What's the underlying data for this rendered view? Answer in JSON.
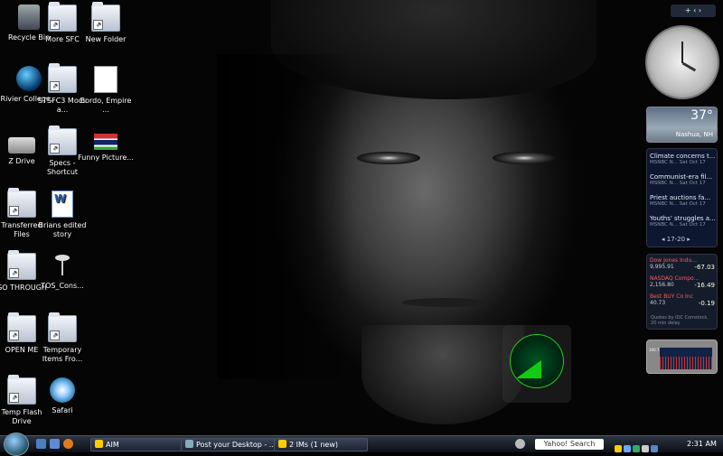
{
  "desktop_icons": [
    {
      "label": "Recycle Bin",
      "icon": "recycle-bin-icon"
    },
    {
      "label": "More SFC",
      "icon": "folder-icon"
    },
    {
      "label": "New Folder",
      "icon": "folder-icon"
    },
    {
      "label": "Rivier College...",
      "icon": "globe-icon"
    },
    {
      "label": "STSFC3 Mods a...",
      "icon": "folder-icon"
    },
    {
      "label": "Bordo, Empire ...",
      "icon": "pdf-document-icon"
    },
    {
      "label": "Z Drive",
      "icon": "network-drive-icon"
    },
    {
      "label": "Specs - Shortcut",
      "icon": "folder-icon"
    },
    {
      "label": "Funny Picture...",
      "icon": "image-icon"
    },
    {
      "label": "Transferred Files",
      "icon": "folder-icon"
    },
    {
      "label": "Brians edited story",
      "icon": "word-document-icon"
    },
    {
      "label": "GO THROUGH",
      "icon": "folder-icon"
    },
    {
      "label": "TOS_Cons...",
      "icon": "starship-icon"
    },
    {
      "label": "OPEN ME",
      "icon": "folder-icon"
    },
    {
      "label": "Temporary Items Fro...",
      "icon": "folder-icon"
    },
    {
      "label": "Temp Flash Drive",
      "icon": "folder-icon"
    },
    {
      "label": "Safari",
      "icon": "safari-icon"
    }
  ],
  "sidebar": {
    "controls": "+  ‹  ›"
  },
  "weather": {
    "temp": "37°",
    "city": "Nashua, NH"
  },
  "news": {
    "items": [
      {
        "title": "Climate concerns t...",
        "meta": "MSNBC N...   Sat Oct 17"
      },
      {
        "title": "Communist-era fil...",
        "meta": "MSNBC N...   Sat Oct 17"
      },
      {
        "title": "Priest auctions fa...",
        "meta": "MSNBC N...   Sat Oct 17"
      },
      {
        "title": "Youths' struggles a...",
        "meta": "MSNBC N...   Sat Oct 17"
      }
    ],
    "pager": "◂  17-20  ▸"
  },
  "stocks": {
    "items": [
      {
        "name": "Dow Jones Indu...",
        "price": "9,995.91",
        "change": "-67.03"
      },
      {
        "name": "NASDAQ Compo...",
        "price": "2,156.80",
        "change": "-16.49"
      },
      {
        "name": "Best BUY Co Inc",
        "price": "40.73",
        "change": "-0.19"
      }
    ],
    "note": "Quotes by IDC Comstock. 20 min delay"
  },
  "cpu_meter": {
    "labels": "100 75 50 25 0"
  },
  "taskbar": {
    "tasks": [
      {
        "label": "AIM"
      },
      {
        "label": "Post your Desktop - ..."
      },
      {
        "label": "2 IMs (1 new)"
      }
    ],
    "search": "Yahoo! Search",
    "time": "2:31 AM"
  },
  "colors": {
    "stock_down": "#ff5a5a",
    "taskbar": "#1c2333",
    "radar": "#22cc22"
  }
}
